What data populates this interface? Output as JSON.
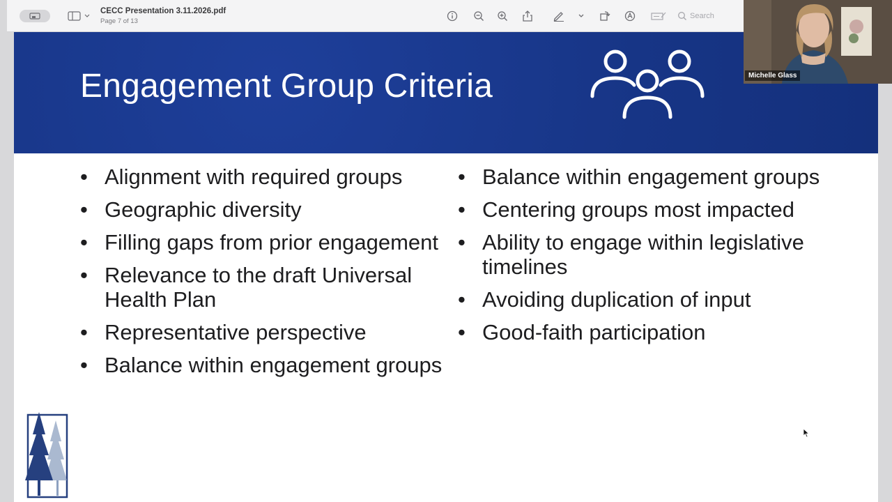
{
  "viewer": {
    "title": "CECC Presentation 3.11.2026.pdf",
    "page_info": "Page 7 of 13",
    "search_placeholder": "Search",
    "icons": [
      "sidebar-icon",
      "info-icon",
      "zoom-out-icon",
      "zoom-in-icon",
      "share-icon",
      "markup-pen-icon",
      "rotate-icon",
      "annotate-icon",
      "form-icon",
      "search-icon"
    ]
  },
  "slide": {
    "title": "Engagement Group Criteria",
    "banner_color": "#173586",
    "bullet": "•",
    "left_items": [
      "Alignment with required groups",
      "Geographic diversity",
      "Filling gaps from prior engagement",
      "Relevance to the draft Universal Health Plan",
      "Representative perspective",
      "Balance within engagement groups"
    ],
    "right_items": [
      "Balance within engagement groups",
      "Centering groups most impacted",
      "Ability to engage within legislative timelines",
      "Avoiding duplication of input",
      "Good-faith participation"
    ]
  },
  "video": {
    "participant_name": "Michelle Glass"
  }
}
